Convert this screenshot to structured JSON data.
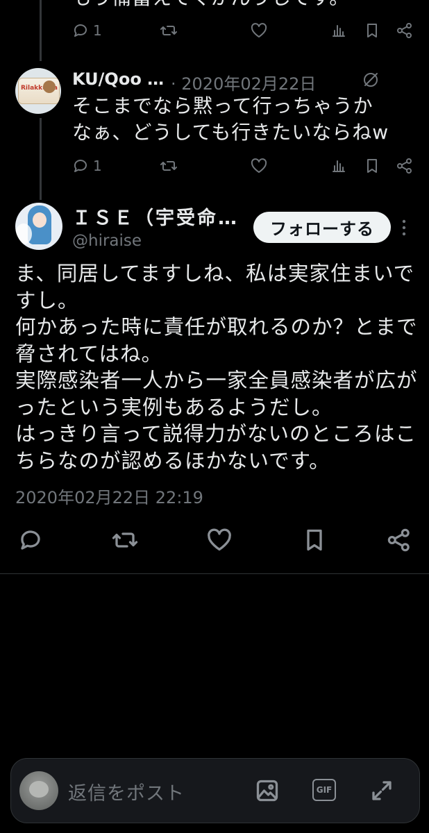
{
  "top_tweet": {
    "partial_text": "もう備蓄えてくがんゔしです。",
    "reply_count": "1"
  },
  "reply_tweet": {
    "author": "KU/Qoo …",
    "date": "· 2020年02月22日",
    "avatar_text": "Rilakkuma",
    "text": "そこまでなら黙って行っちゃうかなぁ、どうしても行きたいならねw",
    "reply_count": "1"
  },
  "main_tweet": {
    "display_name": "ＩＳＥ（宇受命…",
    "handle": "@hiraise",
    "follow_label": "フォローする",
    "text": "ま、同居してますしね、私は実家住まいですし。\n何かあった時に責任が取れるのか？とまで脅されてはね。\n実際感染者一人から一家全員感染者が広がったという実例もあるようだし。\nはっきり言って説得力がないのところはこちらなのが認めるほかないです。",
    "timestamp": "2020年02月22日 22:19"
  },
  "composer": {
    "placeholder": "返信をポスト",
    "gif_label": "GIF"
  },
  "icons": [
    "reply-icon",
    "retweet-icon",
    "like-icon",
    "views-icon",
    "bookmark-icon",
    "share-icon",
    "grok-icon",
    "more-icon",
    "image-icon",
    "gif-icon",
    "expand-icon"
  ]
}
